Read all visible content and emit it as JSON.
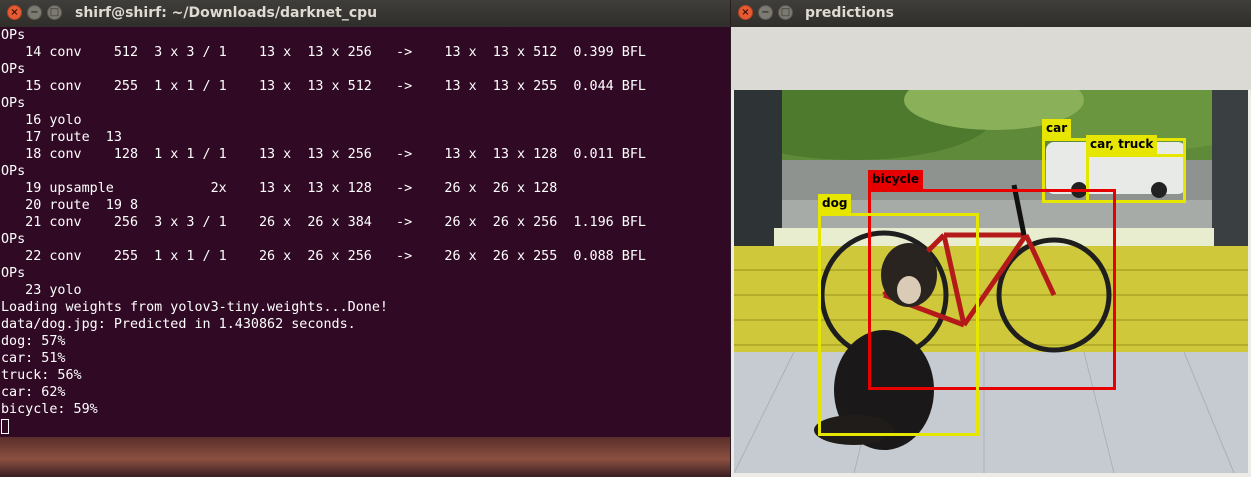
{
  "terminal": {
    "title": "shirf@shirf: ~/Downloads/darknet_cpu",
    "buttons": {
      "close": "×",
      "minimize": "−",
      "maximize": "□"
    },
    "lines": [
      "OPs",
      "   14 conv    512  3 x 3 / 1    13 x  13 x 256   ->    13 x  13 x 512  0.399 BFL",
      "OPs",
      "   15 conv    255  1 x 1 / 1    13 x  13 x 512   ->    13 x  13 x 255  0.044 BFL",
      "OPs",
      "   16 yolo",
      "   17 route  13",
      "   18 conv    128  1 x 1 / 1    13 x  13 x 256   ->    13 x  13 x 128  0.011 BFL",
      "OPs",
      "   19 upsample            2x    13 x  13 x 128   ->    26 x  26 x 128",
      "   20 route  19 8",
      "   21 conv    256  3 x 3 / 1    26 x  26 x 384   ->    26 x  26 x 256  1.196 BFL",
      "OPs",
      "   22 conv    255  1 x 1 / 1    26 x  26 x 256   ->    26 x  26 x 255  0.088 BFL",
      "OPs",
      "   23 yolo",
      "Loading weights from yolov3-tiny.weights...Done!",
      "data/dog.jpg: Predicted in 1.430862 seconds.",
      "dog: 57%",
      "car: 51%",
      "truck: 56%",
      "car: 62%",
      "bicycle: 59%"
    ],
    "colors": {
      "background": "#300a24",
      "text": "#ffffff"
    }
  },
  "predictions": {
    "title": "predictions",
    "buttons": {
      "close": "×",
      "minimize": "−",
      "maximize": "□"
    },
    "detections": [
      {
        "label": "car",
        "color": "#e6e600"
      },
      {
        "label": "car, truck",
        "color": "#e6e600"
      },
      {
        "label": "bicycle",
        "color": "#e60000"
      },
      {
        "label": "dog",
        "color": "#e6e600"
      }
    ]
  }
}
